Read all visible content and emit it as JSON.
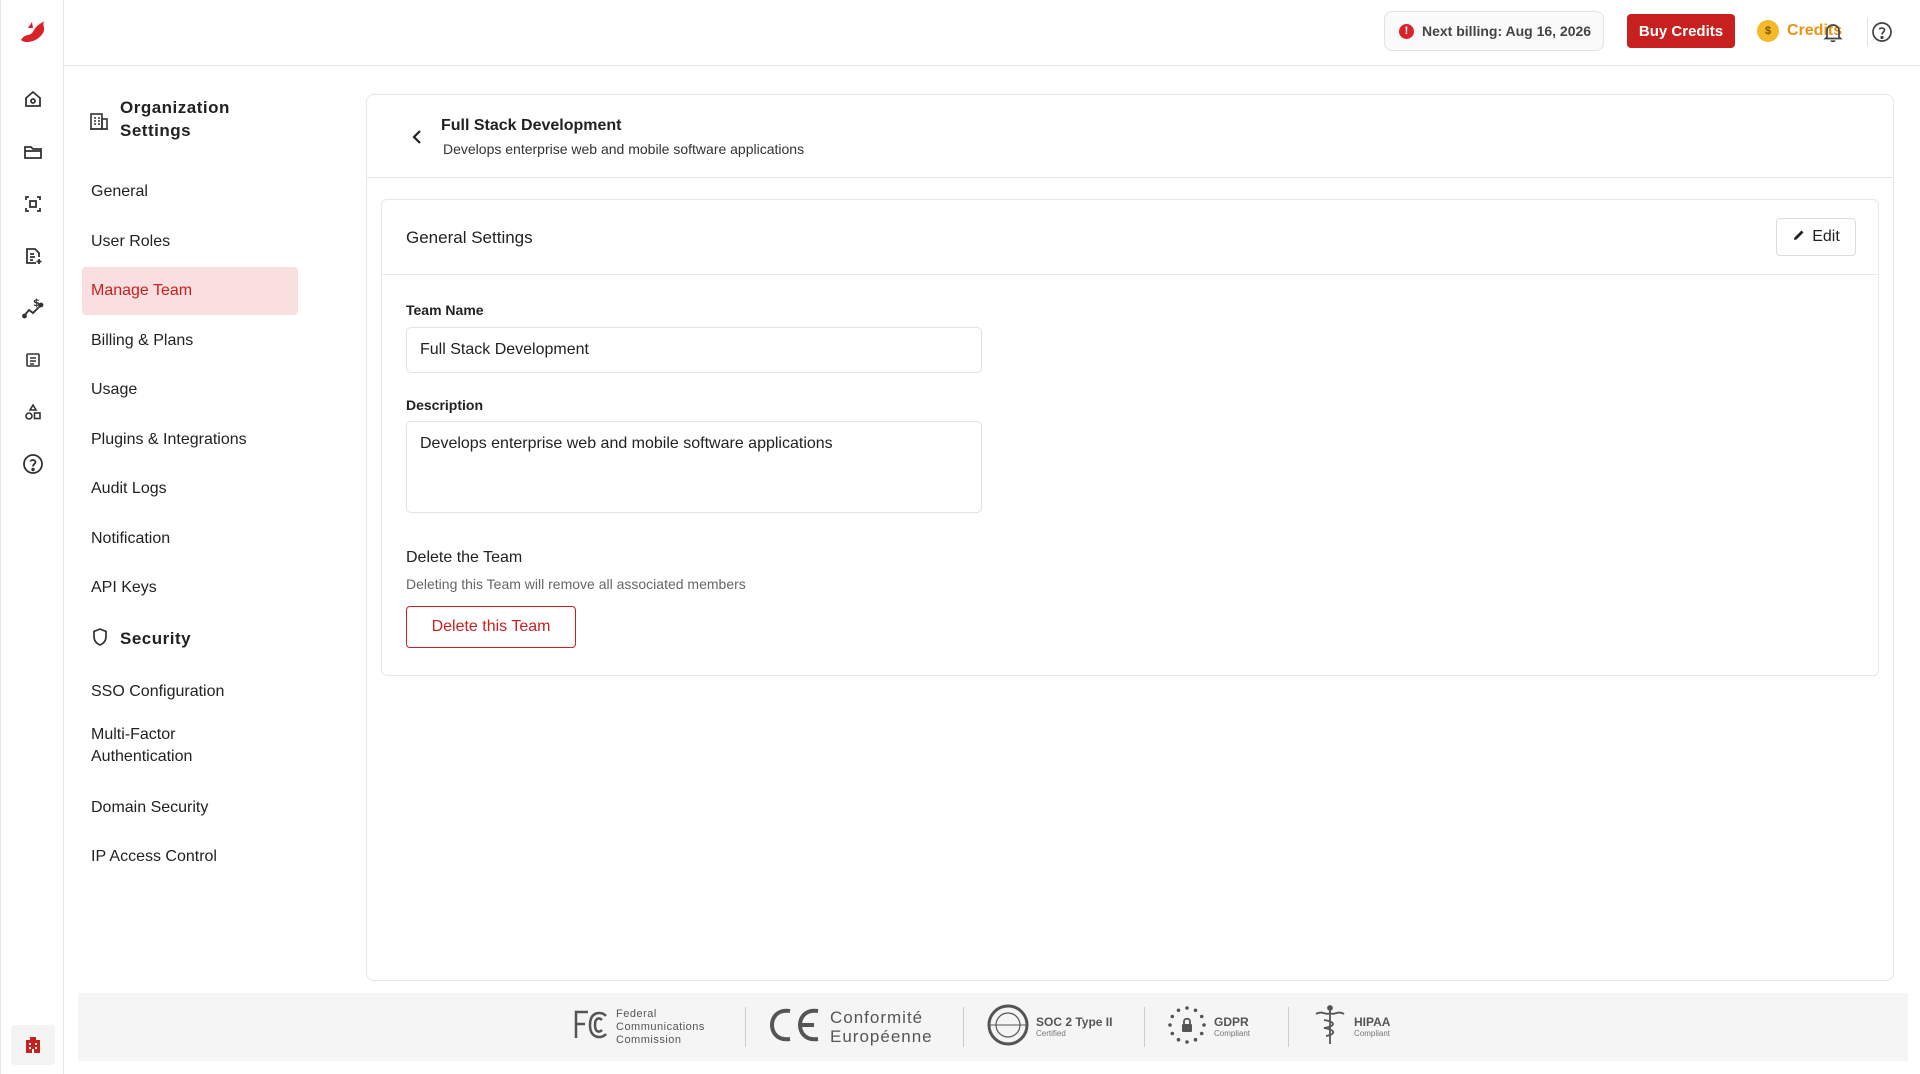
{
  "topbar": {
    "billing_text": "Next billing: Aug 16, 2026",
    "buy_credits_label": "Buy Credits",
    "credits_label": "Credits",
    "coin_symbol": "$"
  },
  "sidebar": {
    "org_header": "Organization Settings",
    "items": [
      {
        "label": "General"
      },
      {
        "label": "User Roles"
      },
      {
        "label": "Manage Team",
        "active": true
      },
      {
        "label": "Billing & Plans"
      },
      {
        "label": "Usage"
      },
      {
        "label": "Plugins & Integrations"
      },
      {
        "label": "Audit Logs"
      },
      {
        "label": "Notification"
      },
      {
        "label": "API Keys"
      }
    ],
    "security_header": "Security",
    "security_items": [
      {
        "label": "SSO Configuration"
      },
      {
        "label": "Multi-Factor Authentication"
      },
      {
        "label": "Domain Security"
      },
      {
        "label": "IP Access Control"
      }
    ]
  },
  "main": {
    "title": "Full Stack Development",
    "subtitle": "Develops enterprise web and mobile software applications",
    "section_title": "General Settings",
    "edit_label": "Edit",
    "team_name_label": "Team Name",
    "team_name_value": "Full Stack Development",
    "description_label": "Description",
    "description_value": "Develops enterprise web and mobile software applications",
    "delete_title": "Delete the Team",
    "delete_subtitle": "Deleting this Team will remove all associated members",
    "delete_button": "Delete this Team"
  },
  "footer": {
    "fcc_line1": "Federal",
    "fcc_line2": "Communications",
    "fcc_line3": "Commission",
    "ce_line1": "Conformité",
    "ce_line2": "Européenne",
    "soc_title": "SOC 2 Type II",
    "soc_sub": "Certified",
    "gdpr_title": "GDPR",
    "gdpr_sub": "Compliant",
    "hipaa_title": "HIPAA",
    "hipaa_sub": "Compliant"
  },
  "colors": {
    "brand_red": "#c8201f",
    "active_bg": "#f9dfe0",
    "credits_orange": "#e89313"
  }
}
